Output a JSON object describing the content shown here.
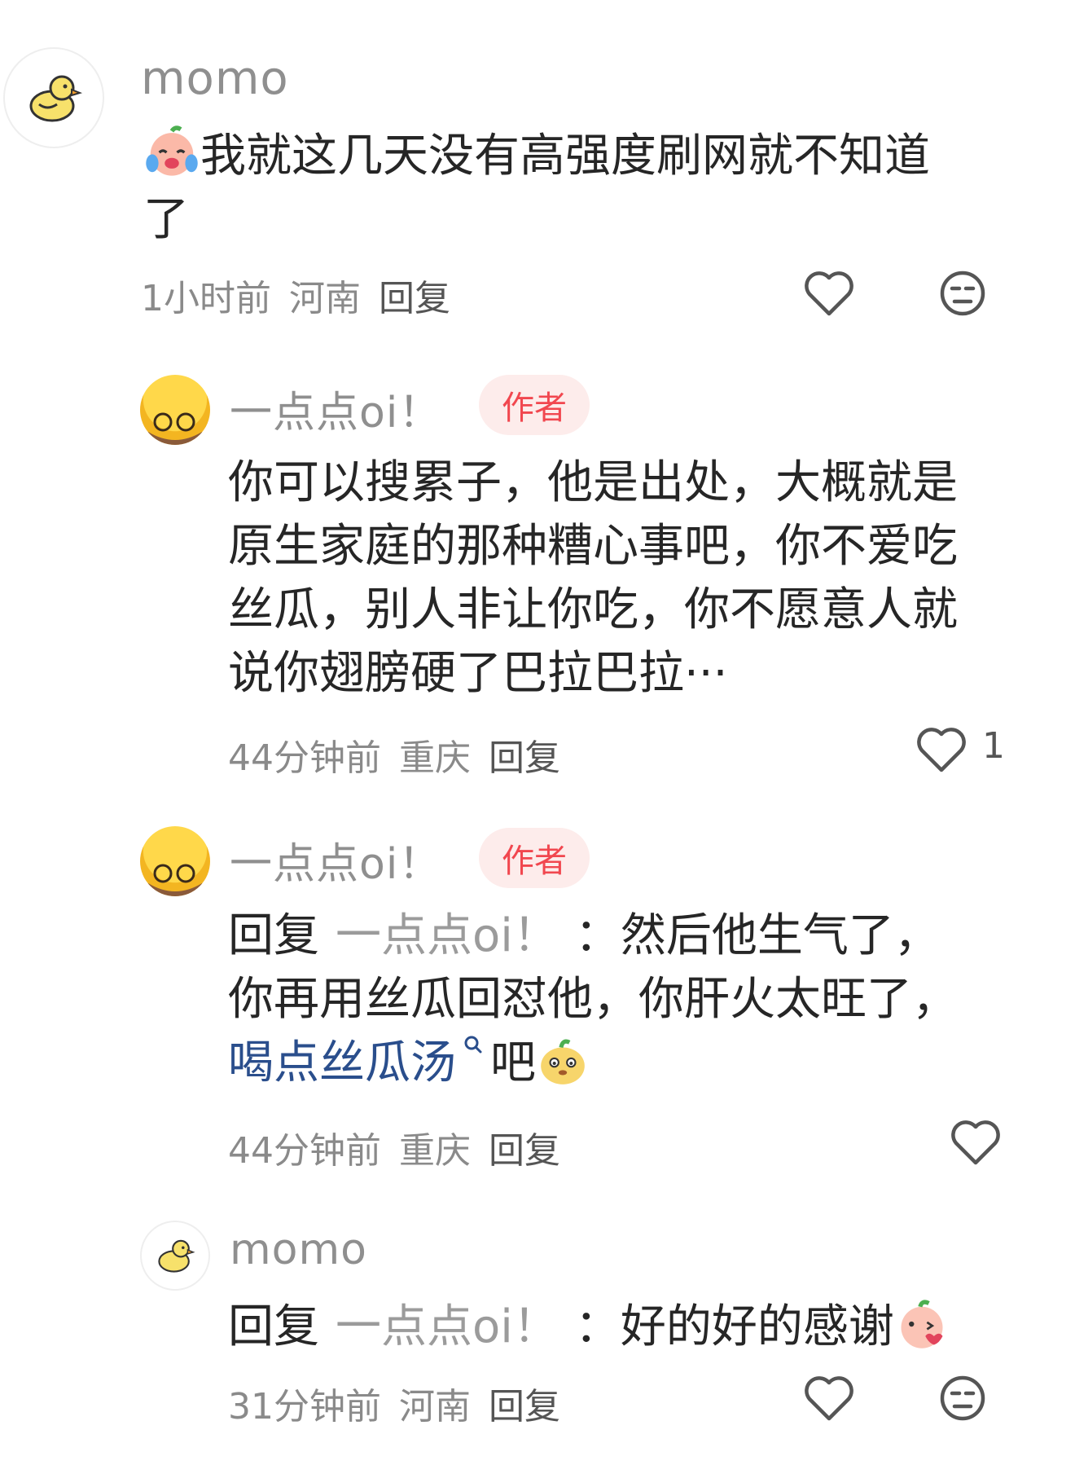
{
  "comments": [
    {
      "user": "momo",
      "text_line1": "我就这几天没有高强度刷网就不知道",
      "text_line2": "了",
      "time": "1小时前",
      "location": "河南",
      "reply_label": "回复"
    },
    {
      "user": "一点点oi！",
      "badge": "作者",
      "lines": [
        "你可以搜累子，他是出处，大概就是",
        "原生家庭的那种糟心事吧，你不爱吃",
        "丝瓜，别人非让你吃，你不愿意人就",
        "说你翅膀硬了巴拉巴拉···"
      ],
      "time": "44分钟前",
      "location": "重庆",
      "reply_label": "回复",
      "like_count": "1"
    },
    {
      "user": "一点点oi！",
      "badge": "作者",
      "reply_prefix": "回复",
      "reply_to": "一点点oi！",
      "colon": "：",
      "line1_rest": "然后他生气了，",
      "line2": "你再用丝瓜回怼他，你肝火太旺了，",
      "link_text": "喝点丝瓜汤",
      "line3_rest": "吧",
      "time": "44分钟前",
      "location": "重庆",
      "reply_label": "回复"
    },
    {
      "user": "momo",
      "reply_prefix": "回复",
      "reply_to": "一点点oi！",
      "colon": "：",
      "text": "好的好的感谢",
      "time": "31分钟前",
      "location": "河南",
      "reply_label": "回复"
    }
  ],
  "icons": {
    "like": "heart-outline-icon",
    "dislike": "neutral-face-icon",
    "link": "search-icon"
  },
  "colors": {
    "badge_bg": "#fdeceb",
    "badge_text": "#f1474f",
    "link": "#2a4e8c",
    "username": "#8f8f8f"
  }
}
